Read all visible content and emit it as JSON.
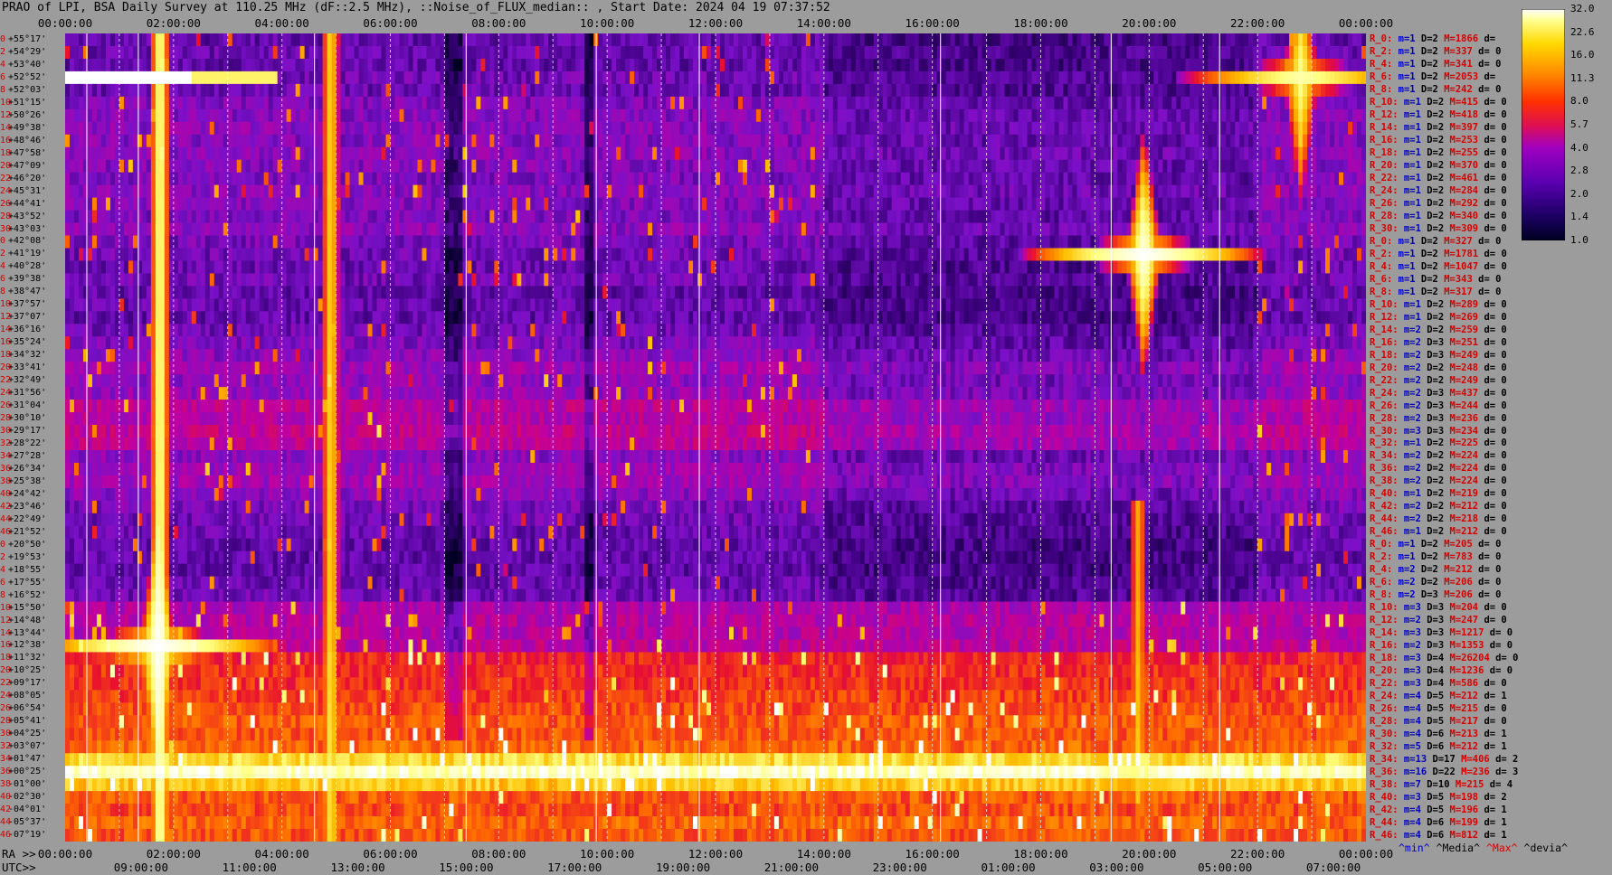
{
  "title": "PRAO of LPI, BSA Daily Survey at 110.25 MHz (dF::2.5 MHz), ::Noise_of_FLUX_median:: , Start Date: 2024 04 19 07:37:52",
  "top_ticks": [
    "00:00:00",
    "02:00:00",
    "04:00:00",
    "06:00:00",
    "08:00:00",
    "10:00:00",
    "12:00:00",
    "14:00:00",
    "16:00:00",
    "18:00:00",
    "20:00:00",
    "22:00:00",
    "00:00:00"
  ],
  "ra_prefix": "RA >>",
  "ra_ticks": [
    "00:00:00",
    "02:00:00",
    "04:00:00",
    "06:00:00",
    "08:00:00",
    "10:00:00",
    "12:00:00",
    "14:00:00",
    "16:00:00",
    "18:00:00",
    "20:00:00",
    "22:00:00",
    "00:00:00"
  ],
  "utc_prefix": "UTC>>",
  "utc_ticks": [
    "09:00:00",
    "11:00:00",
    "13:00:00",
    "15:00:00",
    "17:00:00",
    "19:00:00",
    "21:00:00",
    "23:00:00",
    "01:00:00",
    "03:00:00",
    "05:00:00",
    "07:00:00"
  ],
  "declinations": [
    "+55°17'",
    "+54°29'",
    "+53°40'",
    "+52°52'",
    "+52°03'",
    "+51°15'",
    "+50°26'",
    "+49°38'",
    "+48°46'",
    "+47°58'",
    "+47°09'",
    "+46°20'",
    "+45°31'",
    "+44°41'",
    "+43°52'",
    "+43°03'",
    "+42°08'",
    "+41°19'",
    "+40°28'",
    "+39°38'",
    "+38°47'",
    "+37°57'",
    "+37°07'",
    "+36°16'",
    "+35°24'",
    "+34°32'",
    "+33°41'",
    "+32°49'",
    "+31°56'",
    "+31°04'",
    "+30°10'",
    "+29°17'",
    "+28°22'",
    "+27°28'",
    "+26°34'",
    "+25°38'",
    "+24°42'",
    "+23°46'",
    "+22°49'",
    "+21°52'",
    "+20°50'",
    "+19°53'",
    "+18°55'",
    "+17°55'",
    "+16°52'",
    "+15°50'",
    "+14°48'",
    "+13°44'",
    "+12°38'",
    "+11°32'",
    "+10°25'",
    "+09°17'",
    "+08°05'",
    "+06°54'",
    "+05°41'",
    "+04°25'",
    "+03°07'",
    "+01°47'",
    "+00°25'",
    "-01°00'",
    "-02°30'",
    "-04°01'",
    "-05°37'",
    "-07°19'"
  ],
  "dec_index": [
    "0",
    "2",
    "4",
    "6",
    "8",
    "10",
    "12",
    "14",
    "16",
    "18",
    "20",
    "22",
    "24",
    "26",
    "28",
    "30",
    "0",
    "2",
    "4",
    "6",
    "8",
    "10",
    "12",
    "14",
    "16",
    "18",
    "20",
    "22",
    "24",
    "26",
    "28",
    "30",
    "32",
    "34",
    "36",
    "38",
    "40",
    "42",
    "44",
    "46",
    "0",
    "2",
    "4",
    "6",
    "8",
    "10",
    "12",
    "14",
    "16",
    "18",
    "20",
    "22",
    "24",
    "26",
    "28",
    "30",
    "32",
    "34",
    "36",
    "38",
    "40",
    "42",
    "44",
    "46"
  ],
  "stats": [
    {
      "r": "R_0:",
      "m": "m=1",
      "d": "D=2",
      "M": "M=1866",
      "v": "d="
    },
    {
      "r": "R_2:",
      "m": "m=1",
      "d": "D=2",
      "M": "M=337",
      "v": "d= 0"
    },
    {
      "r": "R_4:",
      "m": "m=1",
      "d": "D=2",
      "M": "M=341",
      "v": "d= 0"
    },
    {
      "r": "R_6:",
      "m": "m=1",
      "d": "D=2",
      "M": "M=2053",
      "v": "d="
    },
    {
      "r": "R_8:",
      "m": "m=1",
      "d": "D=2",
      "M": "M=242",
      "v": "d= 0"
    },
    {
      "r": "R_10:",
      "m": "m=1",
      "d": "D=2",
      "M": "M=415",
      "v": "d= 0"
    },
    {
      "r": "R_12:",
      "m": "m=1",
      "d": "D=2",
      "M": "M=418",
      "v": "d= 0"
    },
    {
      "r": "R_14:",
      "m": "m=1",
      "d": "D=2",
      "M": "M=397",
      "v": "d= 0"
    },
    {
      "r": "R_16:",
      "m": "m=1",
      "d": "D=2",
      "M": "M=253",
      "v": "d= 0"
    },
    {
      "r": "R_18:",
      "m": "m=1",
      "d": "D=2",
      "M": "M=255",
      "v": "d= 0"
    },
    {
      "r": "R_20:",
      "m": "m=1",
      "d": "D=2",
      "M": "M=370",
      "v": "d= 0"
    },
    {
      "r": "R_22:",
      "m": "m=1",
      "d": "D=2",
      "M": "M=461",
      "v": "d= 0"
    },
    {
      "r": "R_24:",
      "m": "m=1",
      "d": "D=2",
      "M": "M=284",
      "v": "d= 0"
    },
    {
      "r": "R_26:",
      "m": "m=1",
      "d": "D=2",
      "M": "M=292",
      "v": "d= 0"
    },
    {
      "r": "R_28:",
      "m": "m=1",
      "d": "D=2",
      "M": "M=340",
      "v": "d= 0"
    },
    {
      "r": "R_30:",
      "m": "m=1",
      "d": "D=2",
      "M": "M=309",
      "v": "d= 0"
    },
    {
      "r": "R_0:",
      "m": "m=1",
      "d": "D=2",
      "M": "M=327",
      "v": "d= 0"
    },
    {
      "r": "R_2:",
      "m": "m=1",
      "d": "D=2",
      "M": "M=1781",
      "v": "d= 0"
    },
    {
      "r": "R_4:",
      "m": "m=1",
      "d": "D=2",
      "M": "M=1047",
      "v": "d= 0"
    },
    {
      "r": "R_6:",
      "m": "m=1",
      "d": "D=2",
      "M": "M=343",
      "v": "d= 0"
    },
    {
      "r": "R_8:",
      "m": "m=1",
      "d": "D=2",
      "M": "M=317",
      "v": "d= 0"
    },
    {
      "r": "R_10:",
      "m": "m=1",
      "d": "D=2",
      "M": "M=289",
      "v": "d= 0"
    },
    {
      "r": "R_12:",
      "m": "m=1",
      "d": "D=2",
      "M": "M=269",
      "v": "d= 0"
    },
    {
      "r": "R_14:",
      "m": "m=2",
      "d": "D=2",
      "M": "M=259",
      "v": "d= 0"
    },
    {
      "r": "R_16:",
      "m": "m=2",
      "d": "D=3",
      "M": "M=251",
      "v": "d= 0"
    },
    {
      "r": "R_18:",
      "m": "m=2",
      "d": "D=3",
      "M": "M=249",
      "v": "d= 0"
    },
    {
      "r": "R_20:",
      "m": "m=2",
      "d": "D=2",
      "M": "M=248",
      "v": "d= 0"
    },
    {
      "r": "R_22:",
      "m": "m=2",
      "d": "D=2",
      "M": "M=249",
      "v": "d= 0"
    },
    {
      "r": "R_24:",
      "m": "m=2",
      "d": "D=3",
      "M": "M=437",
      "v": "d= 0"
    },
    {
      "r": "R_26:",
      "m": "m=2",
      "d": "D=3",
      "M": "M=244",
      "v": "d= 0"
    },
    {
      "r": "R_28:",
      "m": "m=2",
      "d": "D=3",
      "M": "M=236",
      "v": "d= 0"
    },
    {
      "r": "R_30:",
      "m": "m=3",
      "d": "D=3",
      "M": "M=234",
      "v": "d= 0"
    },
    {
      "r": "R_32:",
      "m": "m=1",
      "d": "D=2",
      "M": "M=225",
      "v": "d= 0"
    },
    {
      "r": "R_34:",
      "m": "m=2",
      "d": "D=2",
      "M": "M=224",
      "v": "d= 0"
    },
    {
      "r": "R_36:",
      "m": "m=2",
      "d": "D=2",
      "M": "M=224",
      "v": "d= 0"
    },
    {
      "r": "R_38:",
      "m": "m=2",
      "d": "D=2",
      "M": "M=224",
      "v": "d= 0"
    },
    {
      "r": "R_40:",
      "m": "m=1",
      "d": "D=2",
      "M": "M=219",
      "v": "d= 0"
    },
    {
      "r": "R_42:",
      "m": "m=2",
      "d": "D=2",
      "M": "M=212",
      "v": "d= 0"
    },
    {
      "r": "R_44:",
      "m": "m=2",
      "d": "D=2",
      "M": "M=218",
      "v": "d= 0"
    },
    {
      "r": "R_46:",
      "m": "m=1",
      "d": "D=2",
      "M": "M=212",
      "v": "d= 0"
    },
    {
      "r": "R_0:",
      "m": "m=1",
      "d": "D=2",
      "M": "M=205",
      "v": "d= 0"
    },
    {
      "r": "R_2:",
      "m": "m=1",
      "d": "D=2",
      "M": "M=783",
      "v": "d= 0"
    },
    {
      "r": "R_4:",
      "m": "m=2",
      "d": "D=2",
      "M": "M=212",
      "v": "d= 0"
    },
    {
      "r": "R_6:",
      "m": "m=2",
      "d": "D=2",
      "M": "M=206",
      "v": "d= 0"
    },
    {
      "r": "R_8:",
      "m": "m=2",
      "d": "D=3",
      "M": "M=206",
      "v": "d= 0"
    },
    {
      "r": "R_10:",
      "m": "m=3",
      "d": "D=3",
      "M": "M=204",
      "v": "d= 0"
    },
    {
      "r": "R_12:",
      "m": "m=2",
      "d": "D=3",
      "M": "M=247",
      "v": "d= 0"
    },
    {
      "r": "R_14:",
      "m": "m=3",
      "d": "D=3",
      "M": "M=1217",
      "v": "d= 0"
    },
    {
      "r": "R_16:",
      "m": "m=2",
      "d": "D=3",
      "M": "M=1353",
      "v": "d= 0"
    },
    {
      "r": "R_18:",
      "m": "m=3",
      "d": "D=4",
      "M": "M=26204",
      "v": "d= 0"
    },
    {
      "r": "R_20:",
      "m": "m=3",
      "d": "D=4",
      "M": "M=1236",
      "v": "d= 0"
    },
    {
      "r": "R_22:",
      "m": "m=3",
      "d": "D=4",
      "M": "M=586",
      "v": "d= 0"
    },
    {
      "r": "R_24:",
      "m": "m=4",
      "d": "D=5",
      "M": "M=212",
      "v": "d= 1"
    },
    {
      "r": "R_26:",
      "m": "m=4",
      "d": "D=5",
      "M": "M=215",
      "v": "d= 0"
    },
    {
      "r": "R_28:",
      "m": "m=4",
      "d": "D=5",
      "M": "M=217",
      "v": "d= 0"
    },
    {
      "r": "R_30:",
      "m": "m=4",
      "d": "D=6",
      "M": "M=213",
      "v": "d= 1"
    },
    {
      "r": "R_32:",
      "m": "m=5",
      "d": "D=6",
      "M": "M=212",
      "v": "d= 1"
    },
    {
      "r": "R_34:",
      "m": "m=13",
      "d": "D=17",
      "M": "M=406",
      "v": "d= 2"
    },
    {
      "r": "R_36:",
      "m": "m=16",
      "d": "D=22",
      "M": "M=236",
      "v": "d= 3"
    },
    {
      "r": "R_38:",
      "m": "m=7",
      "d": "D=10",
      "M": "M=215",
      "v": "d= 4"
    },
    {
      "r": "R_40:",
      "m": "m=3",
      "d": "D=5",
      "M": "M=198",
      "v": "d= 2"
    },
    {
      "r": "R_42:",
      "m": "m=4",
      "d": "D=5",
      "M": "M=196",
      "v": "d= 1"
    },
    {
      "r": "R_44:",
      "m": "m=4",
      "d": "D=6",
      "M": "M=199",
      "v": "d= 1"
    },
    {
      "r": "R_46:",
      "m": "m=4",
      "d": "D=6",
      "M": "M=812",
      "v": "d= 1"
    }
  ],
  "stats_footer": {
    "min": "^min^",
    "media": "^Media^",
    "max": "^Max^",
    "devia": "^devia^"
  },
  "colors": {
    "min": "#0000c8",
    "media": "#000000",
    "max": "#d80000",
    "devia": "#000000"
  },
  "colorbar": {
    "ticks": [
      "32.0",
      "22.6",
      "16.0",
      "11.3",
      "8.0",
      "5.7",
      "4.0",
      "2.8",
      "2.0",
      "1.4",
      "1.0"
    ]
  },
  "chart_data": {
    "type": "heatmap",
    "title": "PRAO of LPI, BSA Daily Survey at 110.25 MHz (dF::2.5 MHz), ::Noise_of_FLUX_median:: , Start Date: 2024 04 19 07:37:52",
    "x_axis": "RA (hours, 0-24)",
    "y_axis": "Declination rows (64 beams, +55°17' to -07°19')",
    "value_range": [
      1.0,
      32.0
    ],
    "colormap": [
      "#000020",
      "#3a007a",
      "#7a10c8",
      "#c000a0",
      "#e81030",
      "#ff6a00",
      "#ffc000",
      "#ffff80",
      "#ffffff"
    ],
    "rows": 64,
    "cols": 288,
    "row_base": [
      2.0,
      2.1,
      2.0,
      2.2,
      2.1,
      2.4,
      2.5,
      2.6,
      2.5,
      2.6,
      2.5,
      2.4,
      2.6,
      2.5,
      2.4,
      2.6,
      2.3,
      2.2,
      2.1,
      2.2,
      2.0,
      2.1,
      2.0,
      2.2,
      2.4,
      2.6,
      3.0,
      2.7,
      2.8,
      3.6,
      3.4,
      3.8,
      3.6,
      2.6,
      2.9,
      3.0,
      2.6,
      2.3,
      2.2,
      2.1,
      2.0,
      2.0,
      2.0,
      2.1,
      2.2,
      3.2,
      3.4,
      3.4,
      3.6,
      6.0,
      6.5,
      6.5,
      7.0,
      7.5,
      8.0,
      7.8,
      8.4,
      16.0,
      26.0,
      14.0,
      8.0,
      7.5,
      8.5,
      7.8
    ],
    "quiet_ra_range": [
      14.0,
      22.0
    ],
    "vertical_sources": [
      {
        "ra": 1.75,
        "row_from": 0,
        "row_to": 63,
        "value": 24.0
      },
      {
        "ra": 4.9,
        "row_from": 0,
        "row_to": 63,
        "value": 16.0
      },
      {
        "ra": 19.8,
        "row_from": 37,
        "row_to": 60,
        "value": 12.0
      }
    ],
    "bright_spots": [
      {
        "ra": 1.7,
        "row": 48,
        "value": 32.0
      },
      {
        "ra": 19.9,
        "row": 17,
        "value": 32.0
      },
      {
        "ra": 22.8,
        "row": 3,
        "value": 24.0
      }
    ],
    "bright_horizontal_segment": {
      "row": 3,
      "ra_from": 0.0,
      "ra_to": 3.9,
      "value": 32.0
    },
    "dark_vertical_bands": [
      {
        "ra_from": 7.0,
        "ra_to": 7.3
      },
      {
        "ra_from": 9.55,
        "ra_to": 9.75
      }
    ],
    "white_vertical_lines_ra": [
      0.4,
      1.35,
      4.6,
      7.4,
      9.8,
      11.7,
      16.15,
      19.3,
      21.3
    ],
    "dashed_grid": true,
    "colorbar_ticks": [
      32.0,
      22.6,
      16.0,
      11.3,
      8.0,
      5.7,
      4.0,
      2.8,
      2.0,
      1.4,
      1.0
    ]
  }
}
